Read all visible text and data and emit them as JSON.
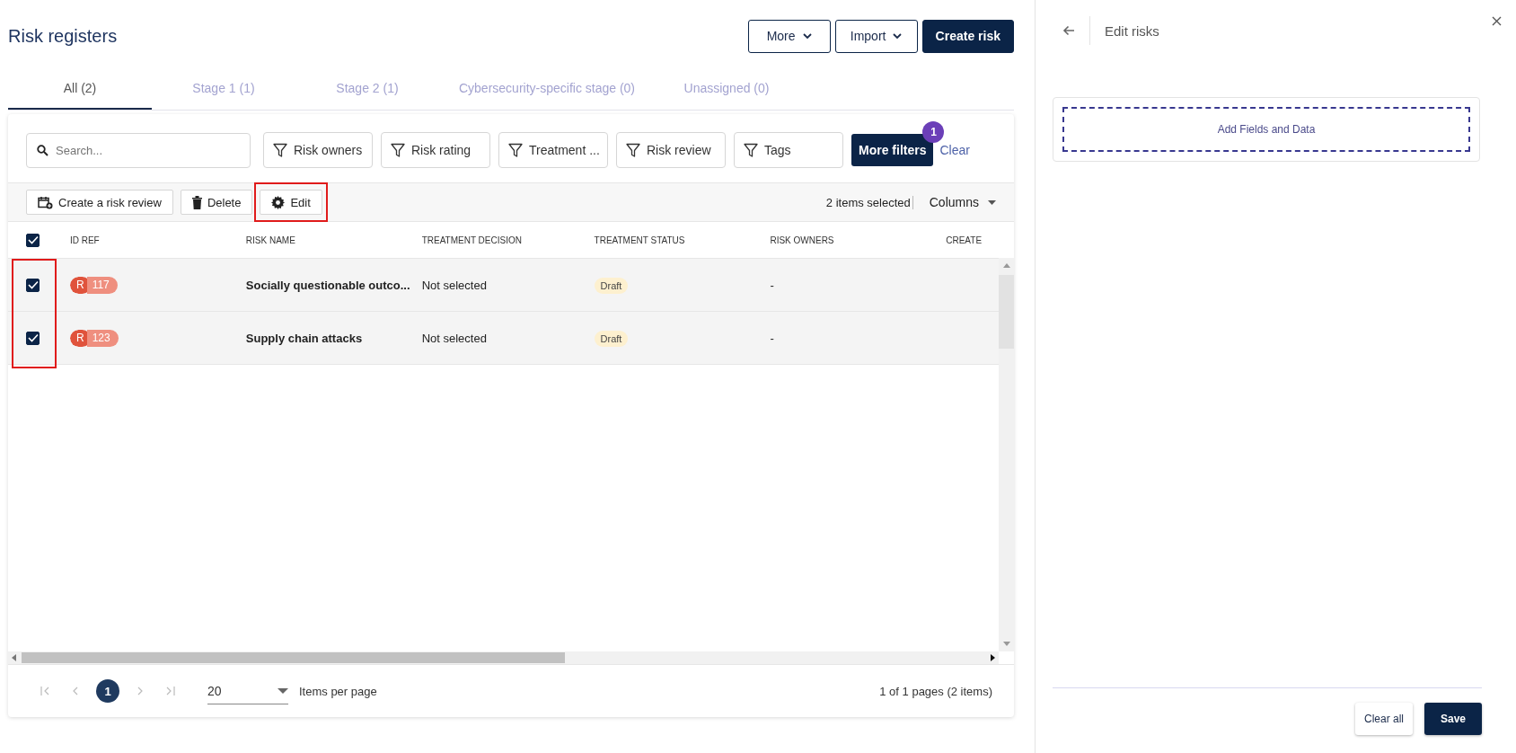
{
  "page": {
    "title": "Risk registers",
    "actions": [
      {
        "label": "More",
        "kind": "menu"
      },
      {
        "label": "Import",
        "kind": "menu"
      },
      {
        "label": "Create risk",
        "kind": "primary"
      }
    ]
  },
  "tabs": [
    {
      "label": "All (2)",
      "selected": true
    },
    {
      "label": "Stage 1 (1)",
      "selected": false
    },
    {
      "label": "Stage 2 (1)",
      "selected": false
    },
    {
      "label": "Cybersecurity-specific stage (0)",
      "selected": false
    },
    {
      "label": "Unassigned (0)",
      "selected": false
    }
  ],
  "search": {
    "placeholder": "Search..."
  },
  "filters": [
    {
      "label": "Risk owners"
    },
    {
      "label": "Risk rating"
    },
    {
      "label": "Treatment ..."
    },
    {
      "label": "Risk review"
    },
    {
      "label": "Tags"
    }
  ],
  "more_filters": {
    "label": "More filters",
    "count": "1"
  },
  "clear_filters": "Clear",
  "toolbar": {
    "actions": [
      {
        "label": "Create a risk review",
        "kind": "calendar",
        "highlighted": false
      },
      {
        "label": "Delete",
        "kind": "trash",
        "highlighted": false
      },
      {
        "label": "Edit",
        "kind": "gear",
        "highlighted": true
      }
    ],
    "selection_text": "2 items selected",
    "columns_button": "Columns"
  },
  "table": {
    "all_selected": true,
    "selection_highlighted": true,
    "columns": [
      "ID REF",
      "RISK NAME",
      "TREATMENT DECISION",
      "TREATMENT STATUS",
      "RISK OWNERS",
      "CREATE"
    ],
    "rows": [
      {
        "selected": true,
        "ref_prefix": "R",
        "ref": "117",
        "name": "Socially questionable outco...",
        "decision": "Not selected",
        "status": "Draft",
        "owners": "-"
      },
      {
        "selected": true,
        "ref_prefix": "R",
        "ref": "123",
        "name": "Supply chain attacks",
        "decision": "Not selected",
        "status": "Draft",
        "owners": "-"
      }
    ]
  },
  "pagination": {
    "pages": [
      {
        "label": "1",
        "selected": true
      }
    ],
    "page_size": "20",
    "page_size_label": "Items per page",
    "summary": "1 of 1 pages (2 items)"
  },
  "panel": {
    "title": "Edit risks",
    "add_fields": "Add Fields and Data",
    "buttons": [
      {
        "label": "Clear all",
        "kind": "secondary"
      },
      {
        "label": "Save",
        "kind": "primary"
      }
    ]
  }
}
